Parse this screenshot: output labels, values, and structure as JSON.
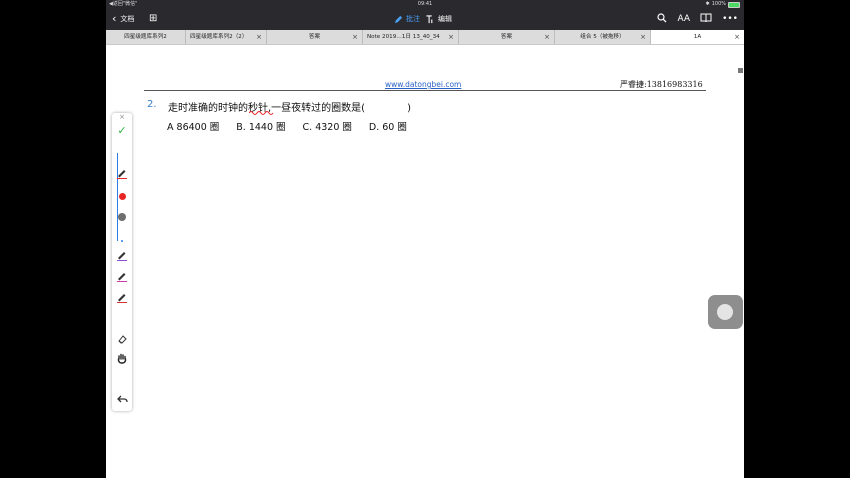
{
  "status_bar": {
    "back_to_app": "◀返回\"微信\"",
    "time": "09:41",
    "bluetooth": "✱",
    "battery_percent": "100%",
    "battery_level": 1.0
  },
  "toolbar": {
    "back_label": "文档",
    "annotate_label": "批注",
    "edit_label": "编辑",
    "font_size_label": "AA",
    "more_label": "•••"
  },
  "tabs": [
    {
      "label": "四星级题库系列2",
      "closable": false,
      "active": false
    },
    {
      "label": "四星级题库系列2（2）",
      "closable": true,
      "active": false
    },
    {
      "label": "答案",
      "closable": true,
      "active": false
    },
    {
      "label": "Note 2019…1日 13_40_34",
      "closable": true,
      "active": false
    },
    {
      "label": "答案",
      "closable": true,
      "active": false
    },
    {
      "label": "组合 5（被拖移）",
      "closable": true,
      "active": false
    },
    {
      "label": "1A",
      "closable": true,
      "active": true
    }
  ],
  "document": {
    "website": "www.datongbei.com",
    "contact": "严睿捷:13816983316",
    "question_number": "2.",
    "question_text_before": "走时准确的时钟的",
    "question_text_marked": "秒针",
    "question_text_after": ",一昼夜转过的圈数是(",
    "question_text_close": ")",
    "choices": [
      "A  86400  圈",
      "B.  1440  圈",
      "C.  4320  圈",
      "D.  60  圈"
    ]
  },
  "palette": {
    "close": "×",
    "done": "✓",
    "colors": {
      "red": "#e82424",
      "gray": "#6e6e6e",
      "pen_purple": "#8a4fd6",
      "pen_pink": "#d23aa7",
      "pen_magenta": "#c2368f",
      "pen_red": "#d63333",
      "ink_blue": "#2b7de9"
    }
  }
}
